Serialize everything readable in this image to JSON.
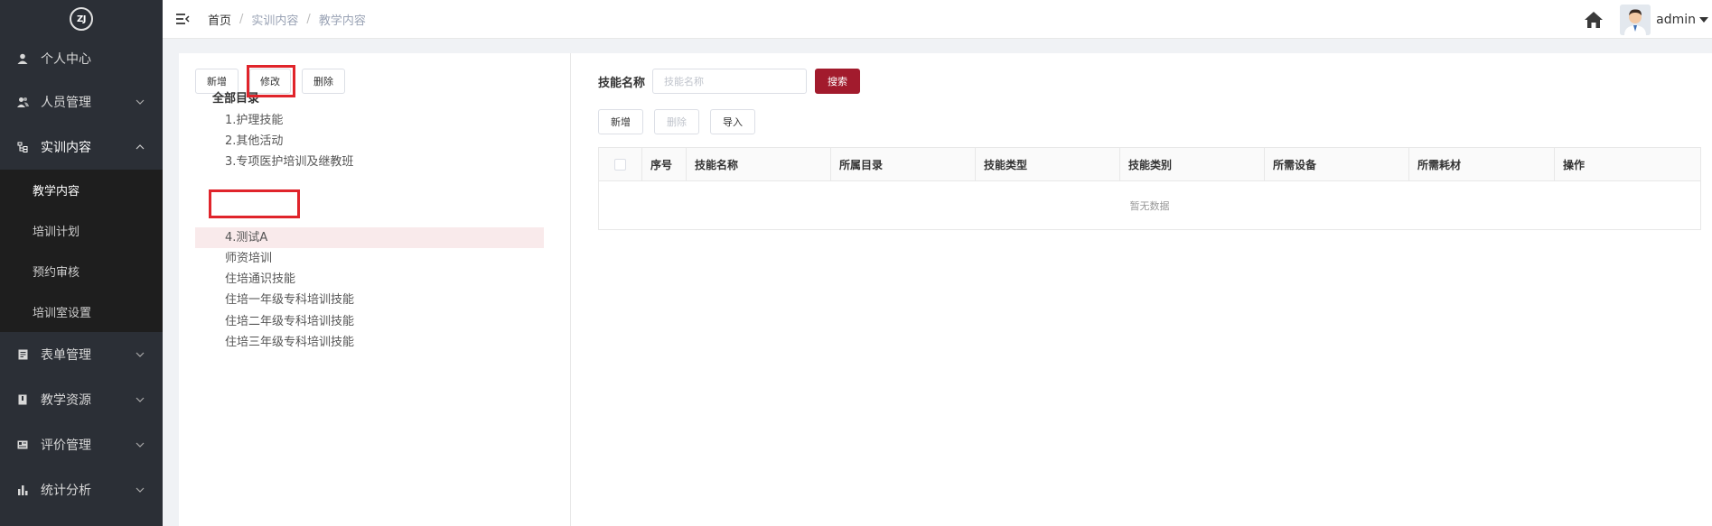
{
  "sidebar": {
    "logo_text": "ZJ",
    "menu": [
      {
        "label": "个人中心",
        "icon": "user-icon",
        "has_children": false
      },
      {
        "label": "人员管理",
        "icon": "users-icon",
        "has_children": true
      },
      {
        "label": "实训内容",
        "icon": "tree-icon",
        "has_children": true,
        "expanded": true
      }
    ],
    "submenu": [
      {
        "label": "教学内容",
        "current": true
      },
      {
        "label": "培训计划"
      },
      {
        "label": "预约审核"
      },
      {
        "label": "培训室设置"
      }
    ],
    "menu_after": [
      {
        "label": "表单管理",
        "icon": "form-icon"
      },
      {
        "label": "教学资源",
        "icon": "book-icon"
      },
      {
        "label": "评价管理",
        "icon": "card-icon"
      },
      {
        "label": "统计分析",
        "icon": "bar-chart-icon"
      }
    ]
  },
  "header": {
    "breadcrumb": [
      "首页",
      "实训内容",
      "教学内容"
    ],
    "user": "admin"
  },
  "tree_panel": {
    "buttons": {
      "add": "新增",
      "edit": "修改",
      "delete": "删除"
    },
    "root": "全部目录",
    "nodes": [
      "1.护理技能",
      "2.其他活动",
      "3.专项医护培训及继教班",
      "4.测试A",
      "师资培训",
      "住培通识技能",
      "住培一年级专科培训技能",
      "住培二年级专科培训技能",
      "住培三年级专科培训技能"
    ],
    "selected_index": 3
  },
  "table_panel": {
    "search_label": "技能名称",
    "search_placeholder": "技能名称",
    "search_value": "",
    "search_button": "搜索",
    "buttons": {
      "add": "新增",
      "delete": "删除",
      "import": "导入"
    },
    "columns": [
      "序号",
      "技能名称",
      "所属目录",
      "技能类型",
      "技能类别",
      "所需设备",
      "所需耗材",
      "操作"
    ],
    "empty_text": "暂无数据"
  },
  "colors": {
    "sidebar_bg": "#2b2f36",
    "submenu_bg": "#1e1e1e",
    "primary": "#a21b2d",
    "highlight": "#e0242b"
  }
}
